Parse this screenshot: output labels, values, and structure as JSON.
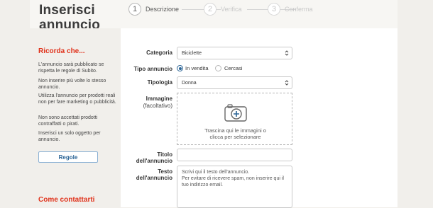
{
  "header": {
    "title": "Inserisci\nannuncio",
    "steps": [
      {
        "number": "1",
        "label": "Descrizione"
      },
      {
        "number": "2",
        "label": "Verifica"
      },
      {
        "number": "3",
        "label": "Conferma"
      }
    ]
  },
  "sidebar": {
    "heading": "Ricorda che...",
    "tips": [
      "L'annuncio sarà pubblicato se rispetta le regole di Subito.",
      "Non inserire più volte lo stesso annuncio.",
      "Utilizza l'annuncio per prodotti reali non per fare marketing o pubblicità.",
      "Non sono accettati prodotti contraffatti o pirati.",
      "Inserisci un solo oggetto per annuncio."
    ],
    "rules_button": "Regole",
    "contact_heading": "Come contattarti"
  },
  "form": {
    "category": {
      "label": "Categoria",
      "value": "Biciclette"
    },
    "ad_type": {
      "label": "Tipo annuncio",
      "options": [
        {
          "label": "In vendita",
          "checked": true
        },
        {
          "label": "Cercasi",
          "checked": false
        }
      ]
    },
    "typology": {
      "label": "Tipologia",
      "value": "Donna"
    },
    "image": {
      "label": "Immagine",
      "sublabel": "(facoltativo)",
      "drop_text": "Trascina qui le immagini o\nclicca per selezionare"
    },
    "title_field": {
      "label": "Titolo dell'annuncio",
      "value": ""
    },
    "text_field": {
      "label": "Testo dell'annuncio",
      "placeholder": "Scrivi qui il testo dell'annuncio.\nPer evitare di ricevere spam, non inserire qui il tuo indirizzo email."
    }
  },
  "colors": {
    "accent_red": "#e0321b",
    "link_blue": "#2a6496",
    "background": "#f1efeb"
  }
}
